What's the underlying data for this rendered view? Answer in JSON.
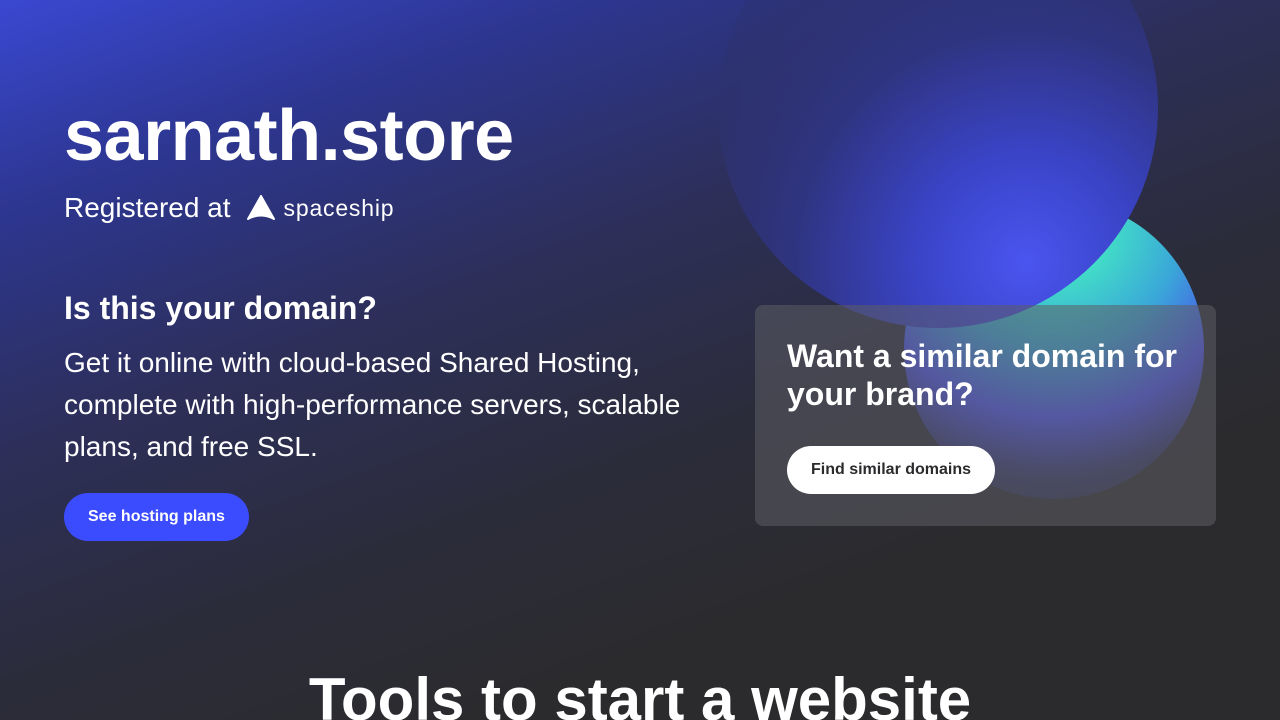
{
  "hero": {
    "domain": "sarnath.store",
    "registered_prefix": "Registered at",
    "registrar_name": "spaceship",
    "registrar_icon": "spaceship-logo-icon",
    "question": "Is this your domain?",
    "description": "Get it online with cloud-based Shared Hosting, complete with high-performance servers, scalable plans, and free SSL.",
    "cta_label": "See hosting plans"
  },
  "similar_card": {
    "title": "Want a similar domain for your brand?",
    "button_label": "Find similar domains"
  },
  "tools": {
    "title": "Tools to start a website"
  },
  "colors": {
    "primary_button": "#3b4cff",
    "secondary_button": "#ffffff",
    "background_dark": "#2b2b2e",
    "background_blue": "#3a48d2",
    "orb_green": "#4ef0cc"
  }
}
